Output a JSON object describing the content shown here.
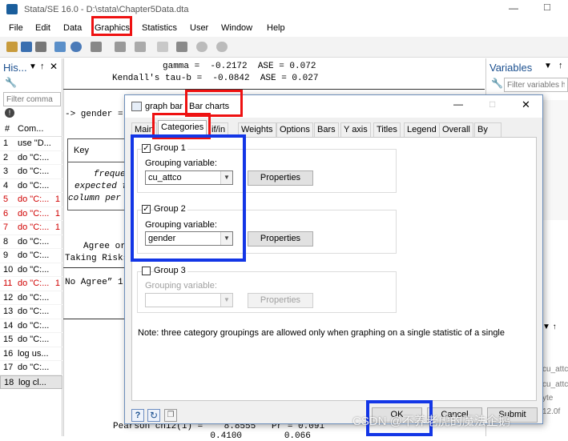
{
  "window": {
    "title": "Stata/SE 16.0 - D:\\stata\\Chapter5Data.dta"
  },
  "menu": [
    "File",
    "Edit",
    "Data",
    "Graphics",
    "Statistics",
    "User",
    "Window",
    "Help"
  ],
  "history": {
    "title": "His...",
    "filter_placeholder": "Filter comma",
    "col_num": "#",
    "col_cmd": "Com...",
    "rows": [
      {
        "n": "1",
        "cmd": "use \"D...",
        "err": false
      },
      {
        "n": "2",
        "cmd": "do \"C:...",
        "err": false
      },
      {
        "n": "3",
        "cmd": "do \"C:...",
        "err": false
      },
      {
        "n": "4",
        "cmd": "do \"C:...",
        "err": false
      },
      {
        "n": "5",
        "cmd": "do \"C:...",
        "err": true,
        "code": "1"
      },
      {
        "n": "6",
        "cmd": "do \"C:...",
        "err": true,
        "code": "1"
      },
      {
        "n": "7",
        "cmd": "do \"C:...",
        "err": true,
        "code": "1"
      },
      {
        "n": "8",
        "cmd": "do \"C:...",
        "err": false
      },
      {
        "n": "9",
        "cmd": "do \"C:...",
        "err": false
      },
      {
        "n": "10",
        "cmd": "do \"C:...",
        "err": false
      },
      {
        "n": "11",
        "cmd": "do \"C:...",
        "err": true,
        "code": "1"
      },
      {
        "n": "12",
        "cmd": "do \"C:...",
        "err": false
      },
      {
        "n": "13",
        "cmd": "do \"C:...",
        "err": false
      },
      {
        "n": "14",
        "cmd": "do \"C:...",
        "err": false
      },
      {
        "n": "15",
        "cmd": "do \"C:...",
        "err": false
      },
      {
        "n": "16",
        "cmd": "log us...",
        "err": false
      },
      {
        "n": "17",
        "cmd": "do \"C:...",
        "err": false
      },
      {
        "n": "18",
        "cmd": "log cl...",
        "err": false,
        "selected": true
      }
    ]
  },
  "results": {
    "gamma": "gamma =  -0.2172  ASE = 0.072",
    "kendall": "Kendall's tau-b =  -0.0842  ASE = 0.027",
    "gender_cmd": "-> gender = N",
    "key": "Key",
    "freq": "freque",
    "expected": "expected f",
    "colpct": "column per",
    "agree": "Agree or",
    "taking_risks": "Taking Risks",
    "no_agree": "No Agree” 1 “",
    "pearson1": "Pearson chi2(1) =    8.8555   Pr = 0.091",
    "pearson2": "         0.4100        0.066"
  },
  "variables": {
    "title": "Variables",
    "filter_placeholder": "Filter variables h",
    "frag1": "cu_attc",
    "frag2": "cu_attc",
    "frag3": "yte",
    "frag4": "12.0f"
  },
  "dialog": {
    "title_cmd": "graph bar",
    "title_desc": "Bar charts",
    "tabs": [
      "Main",
      "Categories",
      "if/in",
      "Weights",
      "Options",
      "Bars",
      "Y axis",
      "Titles",
      "Legend",
      "Overall",
      "By"
    ],
    "group1": {
      "label": "Group 1",
      "checked": "✓",
      "var_label": "Grouping variable:",
      "value": "cu_attco",
      "props": "Properties"
    },
    "group2": {
      "label": "Group 2",
      "checked": "✓",
      "var_label": "Grouping variable:",
      "value": "gender",
      "props": "Properties"
    },
    "group3": {
      "label": "Group 3",
      "var_label": "Grouping variable:",
      "value": "",
      "props": "Properties"
    },
    "note": "Note: three category groupings are allowed only when graphing on a single statistic of a single",
    "ok": "OK",
    "cancel": "Cancel",
    "submit": "Submit"
  },
  "watermark": "CSDN @不养老虎的魔法企鹅",
  "colors": {
    "annotation_red": "#ee1111",
    "annotation_blue": "#1336e6",
    "error_text": "#d00000"
  }
}
